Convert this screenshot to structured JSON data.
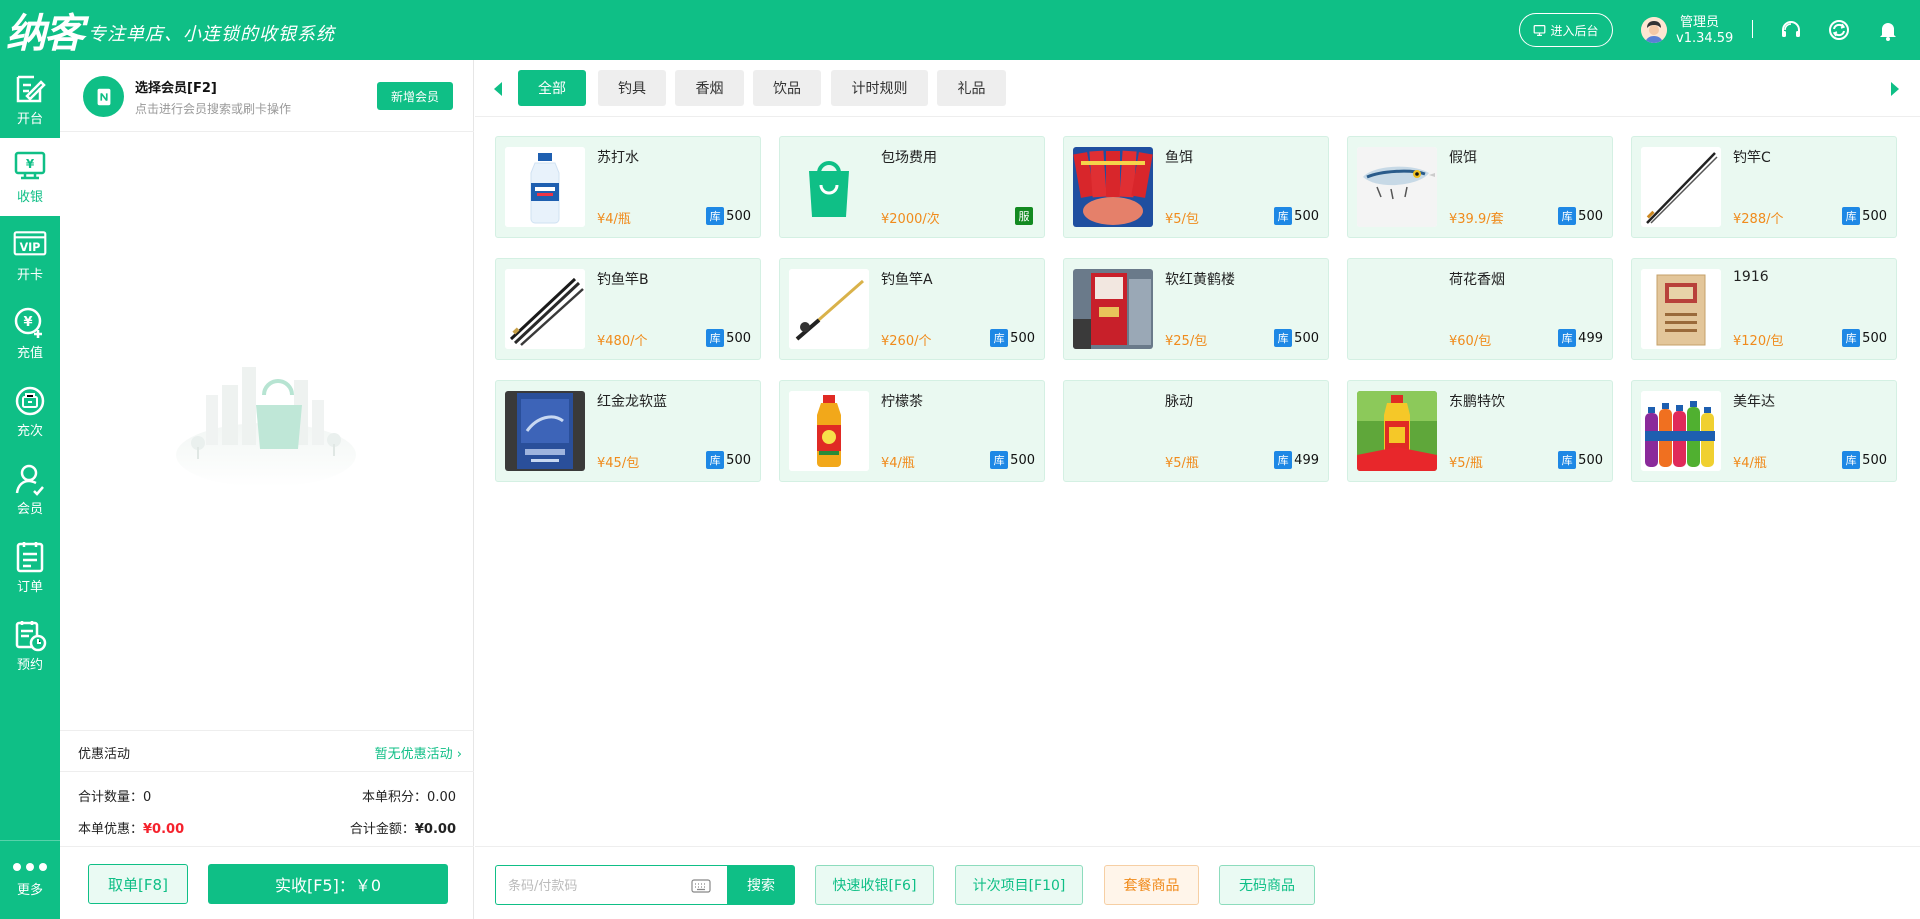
{
  "header": {
    "logo": "纳客",
    "slogan": "专注单店、小连锁的收银系统",
    "admin_button": "进入后台",
    "user_name": "管理员",
    "version": "v1.34.59",
    "icons": [
      "headset-icon",
      "sync-icon",
      "bell-icon"
    ]
  },
  "sidebar": {
    "items": [
      {
        "label": "开台",
        "icon": "open-table-icon"
      },
      {
        "label": "收银",
        "icon": "cashier-icon",
        "active": true
      },
      {
        "label": "开卡",
        "icon": "vip-card-icon"
      },
      {
        "label": "充值",
        "icon": "recharge-icon"
      },
      {
        "label": "充次",
        "icon": "recharge-times-icon"
      },
      {
        "label": "会员",
        "icon": "member-icon"
      },
      {
        "label": "订单",
        "icon": "order-icon"
      },
      {
        "label": "预约",
        "icon": "reservation-icon"
      }
    ],
    "more": "更多"
  },
  "member": {
    "title": "选择会员[F2]",
    "subtitle": "点击进行会员搜索或刷卡操作",
    "new_button": "新增会员"
  },
  "promotion": {
    "label": "优惠活动",
    "value": "暂无优惠活动"
  },
  "summary": {
    "qty_label": "合计数量：",
    "qty_value": "0",
    "points_label": "本单积分：",
    "points_value": "0.00",
    "discount_label": "本单优惠：",
    "discount_value": "¥0.00",
    "total_label": "合计金额：",
    "total_value": "¥0.00"
  },
  "actions": {
    "cancel": "取单[F8]",
    "pay": "实收[F5]：￥0"
  },
  "tabs": [
    {
      "label": "全部",
      "active": true
    },
    {
      "label": "钓具"
    },
    {
      "label": "香烟"
    },
    {
      "label": "饮品"
    },
    {
      "label": "计时规则"
    },
    {
      "label": "礼品"
    }
  ],
  "products": [
    {
      "name": "苏打水",
      "price": "¥4/瓶",
      "stock_badge": "库",
      "stock": "500",
      "image": "water-bottle"
    },
    {
      "name": "包场费用",
      "price": "¥2000/次",
      "stock_badge": "服",
      "stock": "",
      "image": "bag-icon"
    },
    {
      "name": "鱼饵",
      "price": "¥5/包",
      "stock_badge": "库",
      "stock": "500",
      "image": "bait-pack"
    },
    {
      "name": "假饵",
      "price": "¥39.9/套",
      "stock_badge": "库",
      "stock": "500",
      "image": "lure"
    },
    {
      "name": "钓竿C",
      "price": "¥288/个",
      "stock_badge": "库",
      "stock": "500",
      "image": "rod"
    },
    {
      "name": "钓鱼竿B",
      "price": "¥480/个",
      "stock_badge": "库",
      "stock": "500",
      "image": "rods"
    },
    {
      "name": "钓鱼竿A",
      "price": "¥260/个",
      "stock_badge": "库",
      "stock": "500",
      "image": "rod-reel"
    },
    {
      "name": "软红黄鹤楼",
      "price": "¥25/包",
      "stock_badge": "库",
      "stock": "500",
      "image": "cigarette-red"
    },
    {
      "name": "荷花香烟",
      "price": "¥60/包",
      "stock_badge": "库",
      "stock": "499",
      "image": "none"
    },
    {
      "name": "1916",
      "price": "¥120/包",
      "stock_badge": "库",
      "stock": "500",
      "image": "cigarette-box"
    },
    {
      "name": "红金龙软蓝",
      "price": "¥45/包",
      "stock_badge": "库",
      "stock": "500",
      "image": "cigarette-blue"
    },
    {
      "name": "柠檬茶",
      "price": "¥4/瓶",
      "stock_badge": "库",
      "stock": "500",
      "image": "tea-bottle"
    },
    {
      "name": "脉动",
      "price": "¥5/瓶",
      "stock_badge": "库",
      "stock": "499",
      "image": "none"
    },
    {
      "name": "东鹏特饮",
      "price": "¥5/瓶",
      "stock_badge": "库",
      "stock": "500",
      "image": "energy-drink"
    },
    {
      "name": "美年达",
      "price": "¥4/瓶",
      "stock_badge": "库",
      "stock": "500",
      "image": "soda-bottles"
    }
  ],
  "bottom": {
    "search_placeholder": "条码/付款码",
    "search_button": "搜索",
    "quick_pay": "快速收银[F6]",
    "count_item": "计次项目[F10]",
    "package": "套餐商品",
    "no_code": "无码商品"
  },
  "colors": {
    "brand": "#0fbf86",
    "price": "#f08b1c",
    "stock_badge": "#1e88e5",
    "service_badge": "#138a21",
    "discount": "#f5222d"
  }
}
